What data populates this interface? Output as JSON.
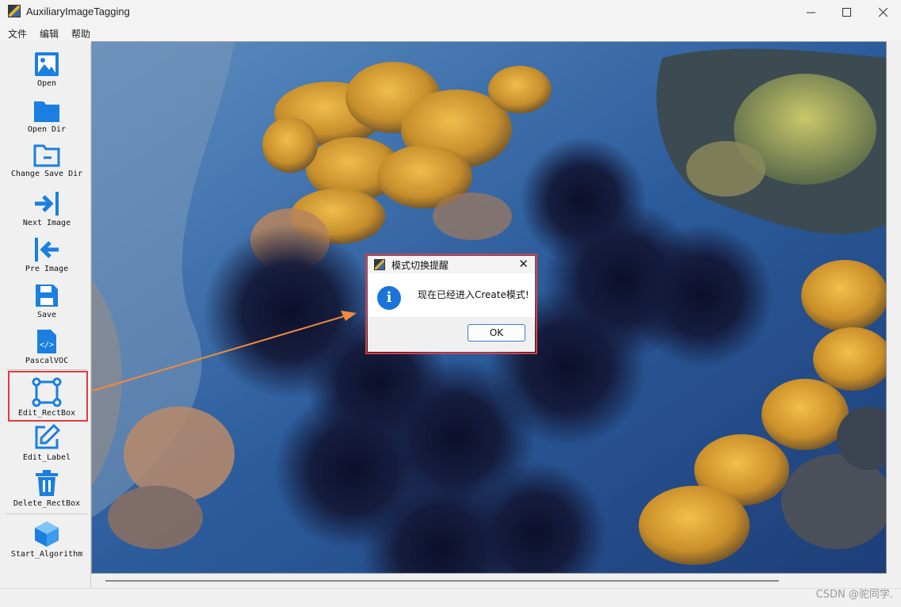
{
  "window": {
    "title": "AuxiliaryImageTagging",
    "minimize_icon": "minimize-icon",
    "maximize_icon": "maximize-icon",
    "close_icon": "close-icon"
  },
  "menu": [
    "文件",
    "编辑",
    "帮助"
  ],
  "toolbar": {
    "open": "Open",
    "open_dir": "Open Dir",
    "change_save_dir": "Change Save Dir",
    "next_image": "Next Image",
    "pre_image": "Pre Image",
    "save": "Save",
    "pascal_voc": "PascalVOC",
    "edit_rectbox": "Edit_RectBox",
    "edit_label": "Edit_Label",
    "delete_rectbox": "Delete_RectBox",
    "start_algorithm": "Start_Algorithm"
  },
  "dialog": {
    "title": "模式切换提醒",
    "message": "现在已经进入Create模式!",
    "ok_label": "OK",
    "icon": "info-icon"
  },
  "watermark": "CSDN @驼同学.",
  "colors": {
    "accent": "#1a7fe0",
    "highlight": "#e23b3b",
    "arrow": "#f08a3c"
  }
}
